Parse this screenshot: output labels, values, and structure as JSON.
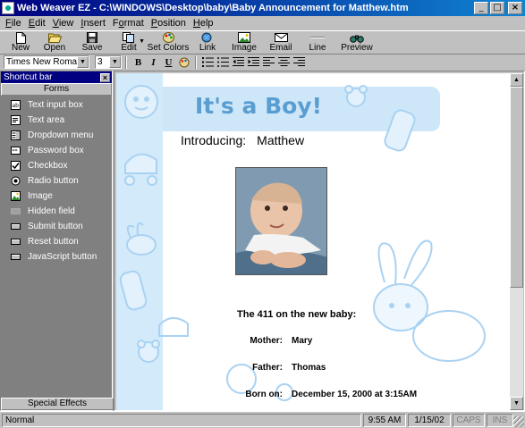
{
  "window": {
    "title": "Web Weaver EZ - C:\\WINDOWS\\Desktop\\baby\\Baby Announcement for Matthew.htm",
    "minimize": "_",
    "maximize": "□",
    "close": "×"
  },
  "menu": [
    "File",
    "Edit",
    "View",
    "Insert",
    "Format",
    "Position",
    "Help"
  ],
  "menu_mnemonics": [
    "F",
    "E",
    "V",
    "I",
    "o",
    "P",
    "H"
  ],
  "toolbar": {
    "new": "New",
    "open": "Open",
    "save": "Save",
    "edit": "Edit",
    "set_colors": "Set Colors",
    "link": "Link",
    "image": "Image",
    "email": "Email",
    "line": "Line",
    "preview": "Preview"
  },
  "format": {
    "font": "Times New Roman",
    "size": "3",
    "bold": "B",
    "italic": "I",
    "underline": "U"
  },
  "shortcut_bar": {
    "title": "Shortcut bar",
    "close": "×",
    "category": "Forms",
    "items": [
      {
        "label": "Text input box",
        "icon": "text-input-icon"
      },
      {
        "label": "Text area",
        "icon": "text-area-icon"
      },
      {
        "label": "Dropdown menu",
        "icon": "dropdown-menu-icon"
      },
      {
        "label": "Password box",
        "icon": "password-box-icon"
      },
      {
        "label": "Checkbox",
        "icon": "checkbox-icon"
      },
      {
        "label": "Radio button",
        "icon": "radio-button-icon"
      },
      {
        "label": "Image",
        "icon": "image-icon"
      },
      {
        "label": "Hidden field",
        "icon": "hidden-field-icon"
      },
      {
        "label": "Submit button",
        "icon": "submit-button-icon"
      },
      {
        "label": "Reset button",
        "icon": "reset-button-icon"
      },
      {
        "label": "JavaScript button",
        "icon": "javascript-button-icon"
      }
    ],
    "bottom_category": "Special Effects"
  },
  "document": {
    "headline": "It's a Boy!",
    "intro_label": "Introducing:",
    "baby_name": "Matthew",
    "stats_title": "The 411 on the new baby:",
    "mother_label": "Mother:",
    "mother": "Mary",
    "father_label": "Father:",
    "father": "Thomas",
    "born_label": "Born on:",
    "born": "December 15, 2000 at 3:15AM"
  },
  "status": {
    "mode": "Normal",
    "time": "9:55 AM",
    "date": "1/15/02",
    "caps": "CAPS",
    "ins": "INS"
  },
  "colors": {
    "title_bar": "#000080",
    "headline": "#5a9dd0",
    "baby_theme": "#d3eafa"
  }
}
